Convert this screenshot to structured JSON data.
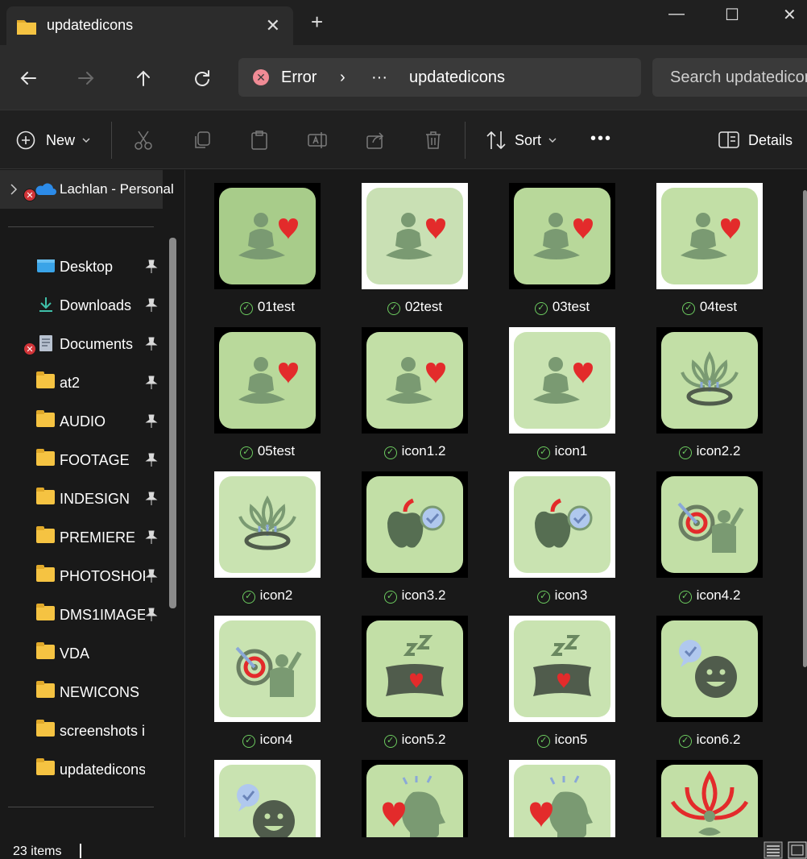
{
  "window": {
    "tab_title": "updatedicons",
    "close_tab": "✕",
    "new_tab": "+",
    "minimize": "—",
    "maximize": "☐",
    "close": "✕"
  },
  "address_bar": {
    "error_label": "Error",
    "separator": "›",
    "ellipsis": "···",
    "current_folder": "updatedicons",
    "search_placeholder": "Search updatedicons"
  },
  "command_bar": {
    "new_label": "New",
    "sort_label": "Sort",
    "more": "•••",
    "details_label": "Details"
  },
  "sidebar": {
    "onedrive_label": "Lachlan - Personal",
    "items": [
      {
        "label": "Desktop",
        "icon": "desktop-icon",
        "pinned": true
      },
      {
        "label": "Downloads",
        "icon": "download-icon",
        "pinned": true
      },
      {
        "label": "Documents",
        "icon": "documents-icon",
        "pinned": true
      },
      {
        "label": "at2",
        "icon": "folder-icon",
        "pinned": true
      },
      {
        "label": "AUDIO",
        "icon": "folder-icon",
        "pinned": true
      },
      {
        "label": "FOOTAGE",
        "icon": "folder-icon",
        "pinned": true
      },
      {
        "label": "INDESIGN",
        "icon": "folder-icon",
        "pinned": true
      },
      {
        "label": "PREMIERE",
        "icon": "folder-icon",
        "pinned": true
      },
      {
        "label": "PHOTOSHOP",
        "icon": "folder-icon",
        "pinned": true
      },
      {
        "label": "DMS1IMAGE",
        "icon": "folder-icon",
        "pinned": true
      },
      {
        "label": "VDA",
        "icon": "folder-icon",
        "pinned": false
      },
      {
        "label": "NEWICONS",
        "icon": "folder-icon",
        "pinned": false
      },
      {
        "label": "screenshots i need",
        "icon": "folder-icon",
        "pinned": false
      },
      {
        "label": "updatedicons",
        "icon": "folder-icon",
        "pinned": false
      }
    ]
  },
  "files": [
    {
      "name": "01test",
      "icon": "meditation-heart-icon",
      "frame": "#000000",
      "tile": "#a8cc8a"
    },
    {
      "name": "02test",
      "icon": "meditation-heart-icon",
      "frame": "#ffffff",
      "tile": "#c9e0b4"
    },
    {
      "name": "03test",
      "icon": "meditation-heart-icon",
      "frame": "#000000",
      "tile": "#b8d89a"
    },
    {
      "name": "04test",
      "icon": "meditation-heart-icon",
      "frame": "#ffffff",
      "tile": "#c2dfa6"
    },
    {
      "name": "05test",
      "icon": "meditation-heart-icon",
      "frame": "#000000",
      "tile": "#b9d99b"
    },
    {
      "name": "icon1.2",
      "icon": "meditation-heart-icon",
      "frame": "#000000",
      "tile": "#c2dfa6"
    },
    {
      "name": "icon1",
      "icon": "meditation-heart-icon",
      "frame": "#ffffff",
      "tile": "#c9e3b1"
    },
    {
      "name": "icon2.2",
      "icon": "lotus-bowl-icon",
      "frame": "#000000",
      "tile": "#c2dfa6"
    },
    {
      "name": "icon2",
      "icon": "lotus-bowl-icon",
      "frame": "#ffffff",
      "tile": "#c9e3b1"
    },
    {
      "name": "icon3.2",
      "icon": "apple-check-icon",
      "frame": "#000000",
      "tile": "#c2dfa6"
    },
    {
      "name": "icon3",
      "icon": "apple-check-icon",
      "frame": "#ffffff",
      "tile": "#c9e3b1"
    },
    {
      "name": "icon4.2",
      "icon": "target-person-icon",
      "frame": "#000000",
      "tile": "#c2dfa6"
    },
    {
      "name": "icon4",
      "icon": "target-person-icon",
      "frame": "#ffffff",
      "tile": "#c9e3b1"
    },
    {
      "name": "icon5.2",
      "icon": "sleep-pillow-icon",
      "frame": "#000000",
      "tile": "#c2dfa6"
    },
    {
      "name": "icon5",
      "icon": "sleep-pillow-icon",
      "frame": "#ffffff",
      "tile": "#c9e3b1"
    },
    {
      "name": "icon6.2",
      "icon": "smiley-chat-icon",
      "frame": "#000000",
      "tile": "#c2dfa6"
    },
    {
      "name": "",
      "icon": "smiley-chat-icon",
      "frame": "#ffffff",
      "tile": "#c9e3b1"
    },
    {
      "name": "",
      "icon": "head-heart-icon",
      "frame": "#000000",
      "tile": "#c2dfa6"
    },
    {
      "name": "",
      "icon": "head-heart-icon",
      "frame": "#ffffff",
      "tile": "#c9e3b1"
    },
    {
      "name": "",
      "icon": "red-lotus-icon",
      "frame": "#000000",
      "tile": "#c2dfa6"
    }
  ],
  "status": {
    "item_count": "23 items"
  },
  "colors": {
    "accent_red": "#e32b2b",
    "icon_green": "#7a9a72",
    "sync_ok": "#6ccb5f",
    "error_red": "#d13438"
  }
}
